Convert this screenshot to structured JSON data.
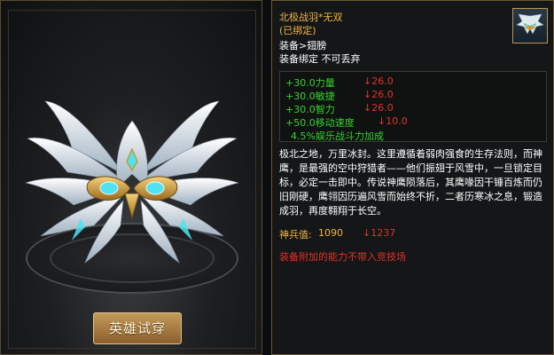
{
  "item": {
    "name": "北极战羽*无双",
    "bound_status": "(已绑定)",
    "slot": "装备>翅膀",
    "bind_rule": "装备绑定 不可丢弃",
    "icon": "wings-icon"
  },
  "stats": [
    {
      "value": "+30.0力量",
      "diff": "↓26.0"
    },
    {
      "value": "+30.0敏捷",
      "diff": "↓26.0"
    },
    {
      "value": "+30.0智力",
      "diff": "↓26.0"
    },
    {
      "value": "+50.0移动速度",
      "diff": "↓10.0"
    }
  ],
  "set_bonus": "4.5%娱乐战斗力加成",
  "description": "极北之地，万里冰封。这里遵循着弱肉强食的生存法则，而神鹰，是最强的空中狩猎者——他们振翅于风雪中，一旦锁定目标，必定一击即中。传说神鹰陨落后，其鹰喙因干锤百炼而仍旧刚硬，鹰翎因历遍风雪而始终不折，二者历寒冰之息，锻造成羽，再度翱翔于长空。",
  "divine": {
    "label": "神兵值:",
    "value": "1090",
    "diff": "↓1237"
  },
  "note": "装备附加的能力不带入竞技场",
  "preview": {
    "try_on_label": "英雄试穿"
  },
  "colors": {
    "gold": "#f0b43c",
    "green": "#31d22a",
    "red": "#e0322a",
    "wing_white": "#e8eef4",
    "wing_gold": "#c9982f",
    "gem_cyan": "#4fe3f0"
  }
}
